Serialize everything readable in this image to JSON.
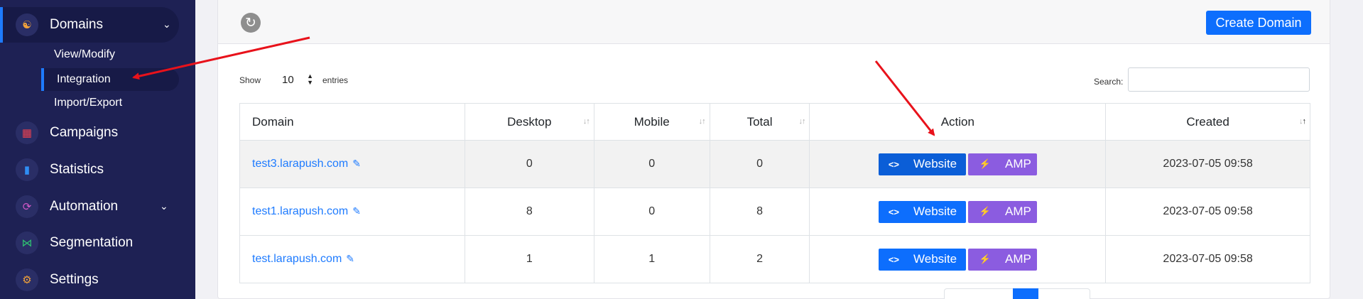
{
  "sidebar": {
    "domains": {
      "label": "Domains",
      "icon": "domains-icon",
      "icon_color": "#f2a23a"
    },
    "sub_items": [
      {
        "label": "View/Modify"
      },
      {
        "label": "Integration"
      },
      {
        "label": "Import/Export"
      }
    ],
    "campaigns": {
      "label": "Campaigns",
      "icon": "calendar-icon",
      "icon_color": "#e8404f"
    },
    "statistics": {
      "label": "Statistics",
      "icon": "bar-chart-icon",
      "icon_color": "#2f8ef5"
    },
    "automation": {
      "label": "Automation",
      "icon": "automation-icon",
      "icon_color": "#d158c7"
    },
    "segmentation": {
      "label": "Segmentation",
      "icon": "segmentation-icon",
      "icon_color": "#2fbf71"
    },
    "settings": {
      "label": "Settings",
      "icon": "gear-icon",
      "icon_color": "#f2a23a"
    }
  },
  "toolbar": {
    "create_label": "Create Domain"
  },
  "controls": {
    "show_label": "Show",
    "entries_value": "10",
    "entries_label": "entries",
    "search_label": "Search:",
    "search_value": ""
  },
  "table": {
    "columns": [
      "Domain",
      "Desktop",
      "Mobile",
      "Total",
      "Action",
      "Created"
    ],
    "rows": [
      {
        "domain": "test3.larapush.com",
        "desktop": "0",
        "mobile": "0",
        "total": "0",
        "created": "2023-07-05 09:58"
      },
      {
        "domain": "test1.larapush.com",
        "desktop": "8",
        "mobile": "0",
        "total": "8",
        "created": "2023-07-05 09:58"
      },
      {
        "domain": "test.larapush.com",
        "desktop": "1",
        "mobile": "1",
        "total": "2",
        "created": "2023-07-05 09:58"
      }
    ],
    "website_label": "Website",
    "amp_label": "AMP"
  },
  "colors": {
    "sidebar_bg": "#1e2154",
    "accent": "#0d6efd",
    "amp": "#8b5ce0",
    "arrow": "#e8121b"
  }
}
